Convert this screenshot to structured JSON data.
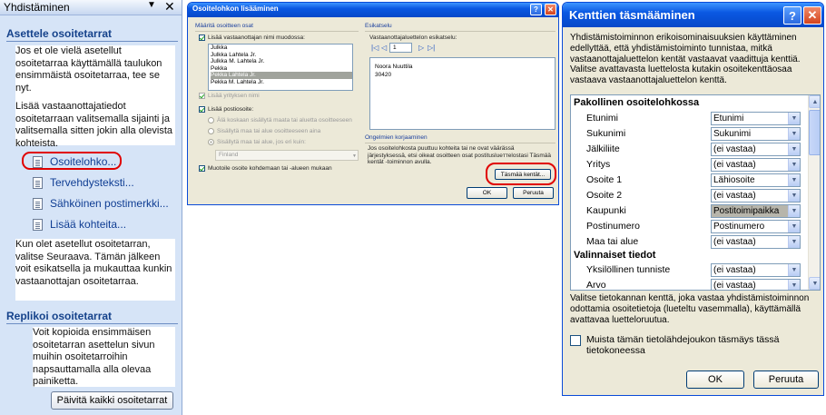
{
  "taskpane": {
    "title": "Yhdistäminen",
    "section1": "Asettele osoitetarrat",
    "para1": "Jos et ole vielä asetellut osoitetarraa käyttämällä taulukon ensimmäistä osoitetarraa, tee se nyt.",
    "para2": "Lisää vastaanottajatiedot osoitetarraan valitsemalla sijainti ja valitsemalla sitten jokin alla olevista kohteista.",
    "links": [
      "Osoitelohko...",
      "Tervehdysteksti...",
      "Sähköinen postimerkki...",
      "Lisää kohteita..."
    ],
    "para3": "Kun olet asetellut osoitetarran, valitse Seuraava. Tämän jälkeen voit esikatsella ja mukauttaa kunkin vastaanottajan osoitetarraa.",
    "section2": "Replikoi osoitetarrat",
    "para4": "Voit kopioida ensimmäisen osoitetarran asettelun sivun muihin osoitetarroihin napsauttamalla alla olevaa painiketta.",
    "update_button": "Päivitä kaikki osoitetarrat"
  },
  "dialog1": {
    "title": "Osoitelohkon lisääminen",
    "group_left": "Määritä osoitteen osat",
    "cb_names": "Lisää vastaanottajan nimi muodossa:",
    "names": [
      "Julkka",
      "Julkka Lahtela Jr.",
      "Julkka M. Lahtela Jr.",
      "Pekka",
      "Pekka Lahtela Jr.",
      "Pekka M. Lahtela Jr."
    ],
    "selected_name": "Pekka Lahtela Jr.",
    "cb_company": "Lisää yrityksen nimi",
    "cb_postal": "Lisää postiosoite:",
    "radio1": "Älä koskaan sisällytä maata tai aluetta osoitteeseen",
    "radio2": "Sisällytä maa tai alue osoitteeseen aina",
    "radio3": "Sisällytä maa tai alue, jos eri kuin:",
    "country": "Finland",
    "cb_format": "Muotoile osoite kohdemaan tai -alueen mukaan",
    "group_right": "Esikatselu",
    "preview_label": "Vastaanottajaluettelon esikatselu:",
    "record_no": "1",
    "preview_lines": [
      "Noora Nuuttila",
      "30420"
    ],
    "fix_group": "Ongelmien korjaaminen",
    "fix_text": "Jos osoitelohkosta puuttuu kohteita tai ne ovat väärässä järjestyksessä, etsi oikeat osoitteen osat postituslueттelostasi Täsmää kentät -toiminnon avulla.",
    "match_button": "Täsmää kentät...",
    "ok": "OK",
    "cancel": "Peruuta"
  },
  "dialog2": {
    "title": "Kenttien täsmääminen",
    "description": "Yhdistämistoiminnon erikoisominaisuuksien käyttäminen edellyttää, että yhdistämistoiminto tunnistaa, mitkä vastaanottajaluettelon kentät vastaavat vaadittuja kenttiä. Valitse avattavasta luettelosta kutakin osoitekenttäosaa vastaava vastaanottajaluettelon kenttä.",
    "required_header": "Pakollinen osoitelohkossa",
    "rows": [
      {
        "label": "Etunimi",
        "value": "Etunimi"
      },
      {
        "label": "Sukunimi",
        "value": "Sukunimi"
      },
      {
        "label": "Jälkiliite",
        "value": "(ei vastaa)"
      },
      {
        "label": "Yritys",
        "value": "(ei vastaa)"
      },
      {
        "label": "Osoite 1",
        "value": "Lähiosoite"
      },
      {
        "label": "Osoite 2",
        "value": "(ei vastaa)"
      },
      {
        "label": "Kaupunki",
        "value": "Postitoimipaikka"
      },
      {
        "label": "Postinumero",
        "value": "Postinumero"
      },
      {
        "label": "Maa tai alue",
        "value": "(ei vastaa)"
      }
    ],
    "optional_header": "Valinnaiset tiedot",
    "optional_rows": [
      {
        "label": "Yksilöllinen tunniste",
        "value": "(ei vastaa)"
      },
      {
        "label": "Arvo",
        "value": "(ei vastaa)"
      }
    ],
    "note": "Valitse tietokannan kenttä, joka vastaa yhdistämistoiminnon odottamia osoitetietoja (lueteltu vasemmalla), käyttämällä avattavaa luetteloruutua.",
    "remember": "Muista tämän tietolähdejoukon täsmäys tässä tietokoneessa",
    "ok": "OK",
    "cancel": "Peruuta"
  }
}
